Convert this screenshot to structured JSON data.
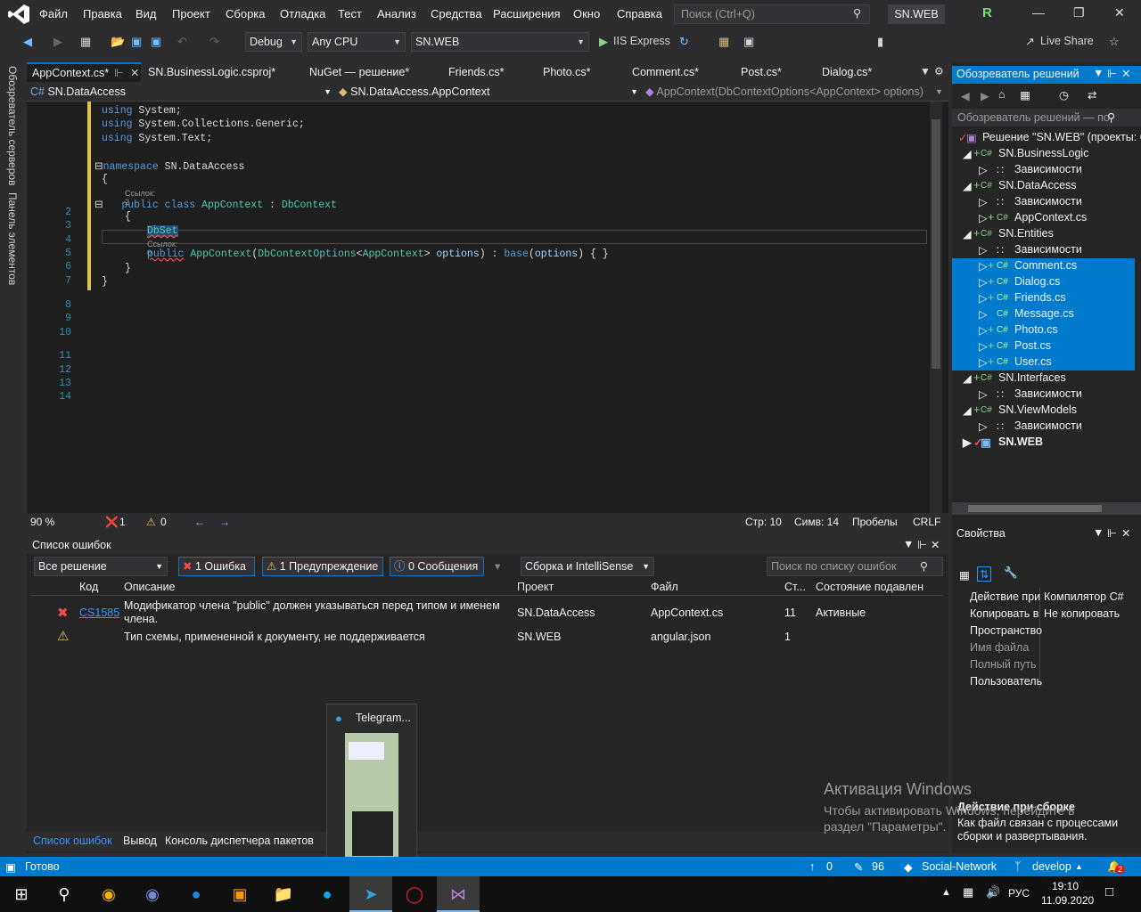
{
  "menu": {
    "items": [
      "Файл",
      "Правка",
      "Вид",
      "Проект",
      "Сборка",
      "Отладка",
      "Тест",
      "Анализ",
      "Средства",
      "Расширения",
      "Окно",
      "Справка"
    ],
    "search_placeholder": "Поиск (Ctrl+Q)",
    "solution_name": "SN.WEB",
    "avatar_letter": "R"
  },
  "toolbar": {
    "config": "Debug",
    "platform": "Any CPU",
    "startup": "SN.WEB",
    "run_label": "IIS Express",
    "live_share": "Live Share"
  },
  "left_strip": {
    "server_explorer": "Обозреватель серверов",
    "toolbox": "Панель элементов"
  },
  "tabs": [
    {
      "label": "AppContext.cs*"
    },
    {
      "label": "SN.BusinessLogic.csproj*"
    },
    {
      "label": "NuGet — решение*"
    },
    {
      "label": "Friends.cs*"
    },
    {
      "label": "Photo.cs*"
    },
    {
      "label": "Comment.cs*"
    },
    {
      "label": "Post.cs*"
    },
    {
      "label": "Dialog.cs*"
    }
  ],
  "navbar": {
    "project": "SN.DataAccess",
    "class": "SN.DataAccess.AppContext",
    "member": "AppContext(DbContextOptions<AppContext> options)"
  },
  "editor": {
    "line_numbers": [
      "2",
      "3",
      "4",
      "5",
      "6",
      "7",
      "8",
      "9",
      "10",
      "11",
      "12",
      "13",
      "14"
    ],
    "lens_refs_2": "Ссылок: 2",
    "lens_refs_0": "Ссылок: 0",
    "dbset": "DbSet"
  },
  "editor_status": {
    "zoom": "90 %",
    "errors": "1",
    "warnings": "0",
    "line": "Стр: 10",
    "col": "Симв: 14",
    "spaces": "Пробелы",
    "eol": "CRLF"
  },
  "error_list": {
    "title": "Список ошибок",
    "scope": "Все решение",
    "errors_btn": "1 Ошибка",
    "warnings_btn": "1 Предупреждение",
    "messages_btn": "0 Сообщения",
    "source": "Сборка и IntelliSense",
    "search_placeholder": "Поиск по списку ошибок",
    "headers": [
      "Код",
      "Описание",
      "Проект",
      "Файл",
      "Ст...",
      "Состояние подавлен"
    ],
    "rows": [
      {
        "code": "CS1585",
        "desc1": "Модификатор члена \"public\" должен указываться перед типом и именем",
        "desc2": "члена.",
        "project": "SN.DataAccess",
        "file": "AppContext.cs",
        "line": "11",
        "state": "Активные"
      },
      {
        "code": "",
        "desc1": "Тип схемы, примененной к документу, не поддерживается",
        "desc2": "",
        "project": "SN.WEB",
        "file": "angular.json",
        "line": "1",
        "state": ""
      }
    ]
  },
  "bottom_tabs": [
    "Список ошибок",
    "Вывод",
    "Консоль диспетчера пакетов"
  ],
  "solution_explorer": {
    "title": "Обозреватель решений",
    "search": "Обозреватель решений — по",
    "items": [
      {
        "label": "Решение \"SN.WEB\" (проекты: 6"
      },
      {
        "label": "SN.BusinessLogic"
      },
      {
        "label": "Зависимости"
      },
      {
        "label": "SN.DataAccess"
      },
      {
        "label": "Зависимости"
      },
      {
        "label": "AppContext.cs"
      },
      {
        "label": "SN.Entities"
      },
      {
        "label": "Зависимости"
      },
      {
        "label": "Comment.cs"
      },
      {
        "label": "Dialog.cs"
      },
      {
        "label": "Friends.cs"
      },
      {
        "label": "Message.cs"
      },
      {
        "label": "Photo.cs"
      },
      {
        "label": "Post.cs"
      },
      {
        "label": "User.cs"
      },
      {
        "label": "SN.Interfaces"
      },
      {
        "label": "Зависимости"
      },
      {
        "label": "SN.ViewModels"
      },
      {
        "label": "Зависимости"
      },
      {
        "label": "SN.WEB"
      }
    ]
  },
  "properties": {
    "title": "Свойства",
    "rows": [
      {
        "k": "Действие при",
        "v": "Компилятор C#"
      },
      {
        "k": "Копировать в",
        "v": "Не копировать"
      },
      {
        "k": "Пространство",
        "v": ""
      },
      {
        "k": "Имя файла",
        "v": ""
      },
      {
        "k": "Полный путь",
        "v": ""
      },
      {
        "k": "Пользователь",
        "v": ""
      }
    ],
    "desc_title": "Действие при сборке",
    "desc_text1": "Как файл связан с процессами",
    "desc_text2": "сборки и развертывания."
  },
  "statusbar": {
    "ready": "Готово",
    "up": "0",
    "edits": "96",
    "repo": "Social-Network",
    "branch": "develop",
    "notif": "2"
  },
  "watermark": {
    "title": "Активация Windows",
    "line1": "Чтобы активировать Windows, перейдите в",
    "line2": "раздел \"Параметры\"."
  },
  "thumbnail": {
    "title": "Telegram..."
  },
  "taskbar": {
    "time": "19:10",
    "date": "11.09.2020",
    "lang": "РУС"
  }
}
